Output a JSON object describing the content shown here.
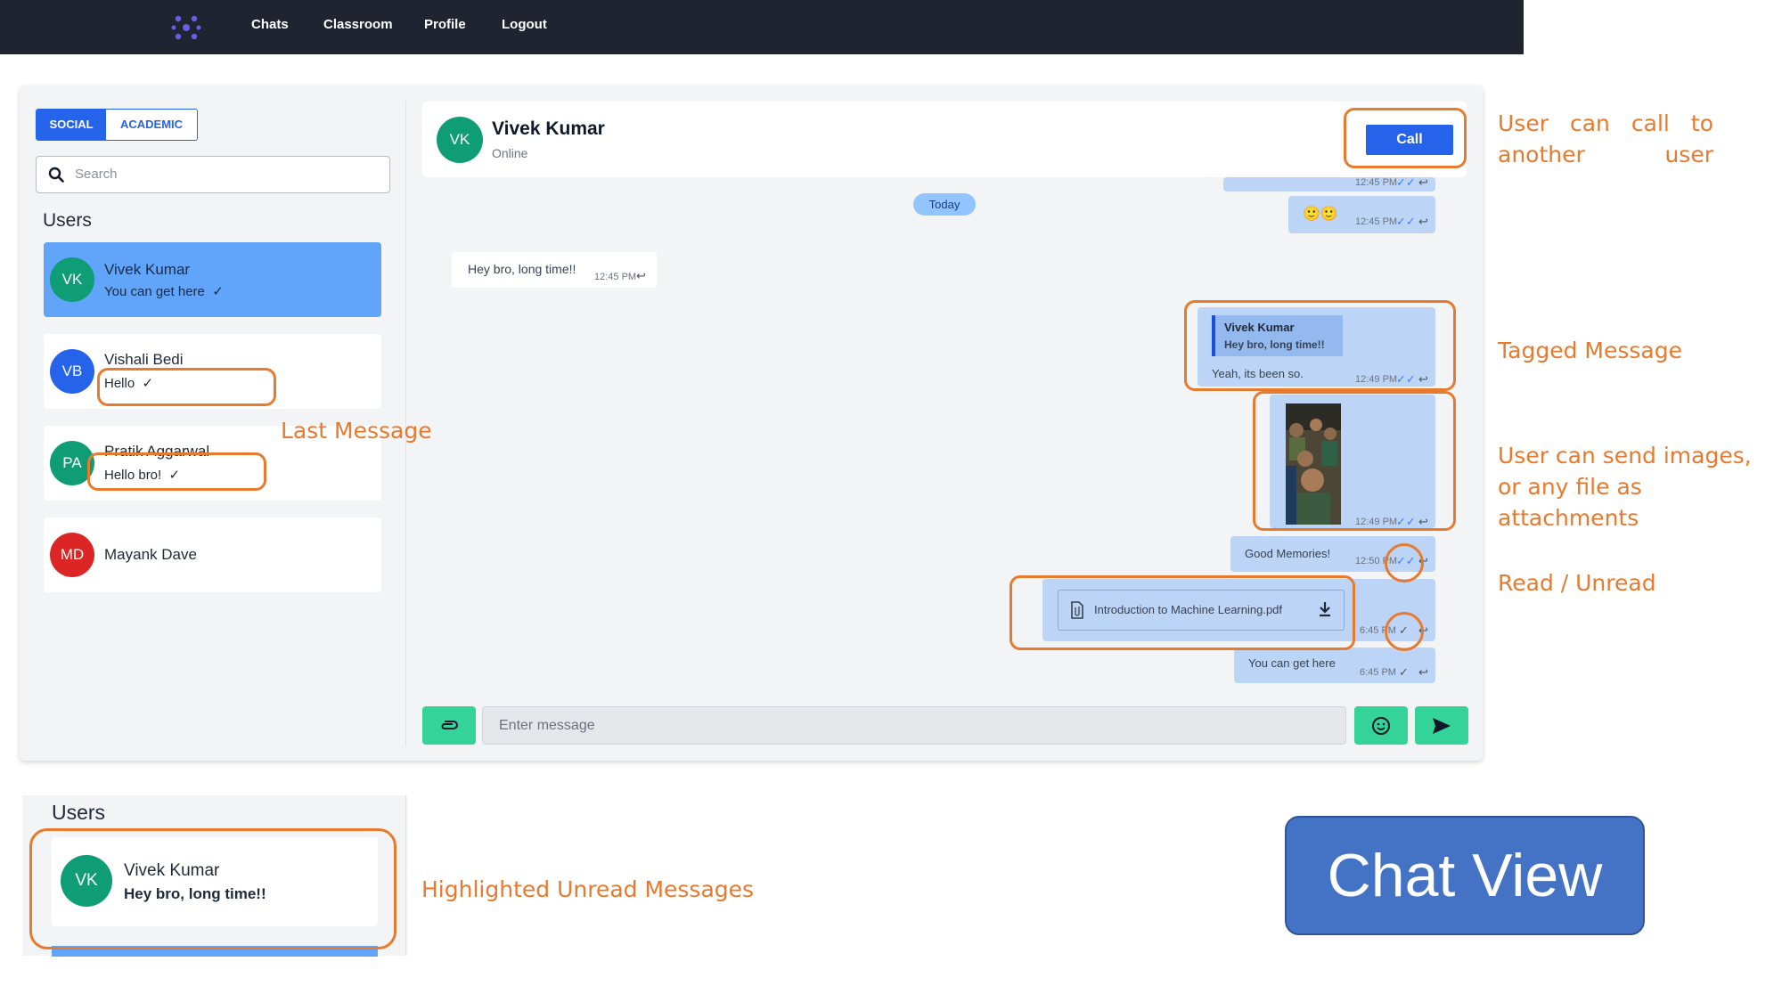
{
  "nav": {
    "logo_icon": "atom-logo-icon",
    "links": [
      "Chats",
      "Classroom",
      "Profile",
      "Logout"
    ]
  },
  "sidebar": {
    "tabs": [
      "SOCIAL",
      "ACADEMIC"
    ],
    "search_placeholder": "Search",
    "users_heading": "Users",
    "users": [
      {
        "initials": "VK",
        "name": "Vivek Kumar",
        "last": "You can get here",
        "tick": "✓",
        "color": "#0f9d76",
        "active": true
      },
      {
        "initials": "VB",
        "name": "Vishali Bedi",
        "last": "Hello",
        "tick": "✓",
        "color": "#2563eb",
        "active": false
      },
      {
        "initials": "PA",
        "name": "Pratik Aggarwal",
        "last": "Hello bro!",
        "tick": "✓",
        "color": "#0f9d76",
        "active": false
      },
      {
        "initials": "MD",
        "name": "Mayank Dave",
        "last": "",
        "tick": "",
        "color": "#dc2626",
        "active": false
      }
    ]
  },
  "chat": {
    "header": {
      "initials": "VK",
      "name": "Vivek Kumar",
      "status": "Online",
      "call_label": "Call"
    },
    "today_label": "Today",
    "messages": {
      "m0": {
        "time": "12:45 PM"
      },
      "m1": {
        "text": "🙂🙂",
        "time": "12:45 PM"
      },
      "m2": {
        "text": "Hey bro, long time!!",
        "time": "12:45 PM"
      },
      "m3": {
        "quote_name": "Vivek Kumar",
        "quote_text": "Hey bro, long time!!",
        "text": "Yeah, its been so.",
        "time": "12:49 PM"
      },
      "m4": {
        "time": "12:49 PM"
      },
      "m5": {
        "text": "Good Memories!",
        "time": "12:50 PM"
      },
      "m6": {
        "file_name": "Introduction to Machine Learning.pdf",
        "time": "6:45 PM"
      },
      "m7": {
        "text": "You can get here",
        "time": "6:45 PM"
      }
    },
    "composer_placeholder": "Enter message"
  },
  "annotations": {
    "call": "User can call to another user",
    "tagged": "Tagged Message",
    "attachments": "User can send images, or any file as attachments",
    "read": "Read / Unread",
    "last_message": "Last Message",
    "highlighted": "Highlighted Unread Messages"
  },
  "inset": {
    "heading": "Users",
    "initials": "VK",
    "name": "Vivek Kumar",
    "last": "Hey bro, long time!!"
  },
  "title_box": "Chat View",
  "colors": {
    "accent": "#2563eb",
    "green": "#34d399",
    "annotation": "#e87a2e",
    "bubble_out": "#bcd4f5"
  }
}
